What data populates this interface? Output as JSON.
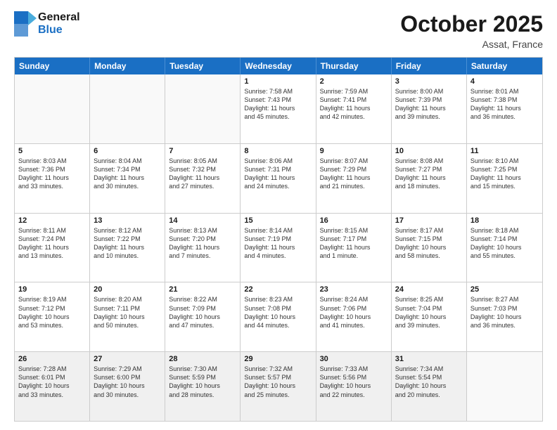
{
  "header": {
    "logo": {
      "line1": "General",
      "line2": "Blue"
    },
    "title": "October 2025",
    "location": "Assat, France"
  },
  "weekdays": [
    "Sunday",
    "Monday",
    "Tuesday",
    "Wednesday",
    "Thursday",
    "Friday",
    "Saturday"
  ],
  "weeks": [
    [
      {
        "day": "",
        "text": "",
        "empty": true
      },
      {
        "day": "",
        "text": "",
        "empty": true
      },
      {
        "day": "",
        "text": "",
        "empty": true
      },
      {
        "day": "1",
        "text": "Sunrise: 7:58 AM\nSunset: 7:43 PM\nDaylight: 11 hours\nand 45 minutes."
      },
      {
        "day": "2",
        "text": "Sunrise: 7:59 AM\nSunset: 7:41 PM\nDaylight: 11 hours\nand 42 minutes."
      },
      {
        "day": "3",
        "text": "Sunrise: 8:00 AM\nSunset: 7:39 PM\nDaylight: 11 hours\nand 39 minutes."
      },
      {
        "day": "4",
        "text": "Sunrise: 8:01 AM\nSunset: 7:38 PM\nDaylight: 11 hours\nand 36 minutes."
      }
    ],
    [
      {
        "day": "5",
        "text": "Sunrise: 8:03 AM\nSunset: 7:36 PM\nDaylight: 11 hours\nand 33 minutes."
      },
      {
        "day": "6",
        "text": "Sunrise: 8:04 AM\nSunset: 7:34 PM\nDaylight: 11 hours\nand 30 minutes."
      },
      {
        "day": "7",
        "text": "Sunrise: 8:05 AM\nSunset: 7:32 PM\nDaylight: 11 hours\nand 27 minutes."
      },
      {
        "day": "8",
        "text": "Sunrise: 8:06 AM\nSunset: 7:31 PM\nDaylight: 11 hours\nand 24 minutes."
      },
      {
        "day": "9",
        "text": "Sunrise: 8:07 AM\nSunset: 7:29 PM\nDaylight: 11 hours\nand 21 minutes."
      },
      {
        "day": "10",
        "text": "Sunrise: 8:08 AM\nSunset: 7:27 PM\nDaylight: 11 hours\nand 18 minutes."
      },
      {
        "day": "11",
        "text": "Sunrise: 8:10 AM\nSunset: 7:25 PM\nDaylight: 11 hours\nand 15 minutes."
      }
    ],
    [
      {
        "day": "12",
        "text": "Sunrise: 8:11 AM\nSunset: 7:24 PM\nDaylight: 11 hours\nand 13 minutes."
      },
      {
        "day": "13",
        "text": "Sunrise: 8:12 AM\nSunset: 7:22 PM\nDaylight: 11 hours\nand 10 minutes."
      },
      {
        "day": "14",
        "text": "Sunrise: 8:13 AM\nSunset: 7:20 PM\nDaylight: 11 hours\nand 7 minutes."
      },
      {
        "day": "15",
        "text": "Sunrise: 8:14 AM\nSunset: 7:19 PM\nDaylight: 11 hours\nand 4 minutes."
      },
      {
        "day": "16",
        "text": "Sunrise: 8:15 AM\nSunset: 7:17 PM\nDaylight: 11 hours\nand 1 minute."
      },
      {
        "day": "17",
        "text": "Sunrise: 8:17 AM\nSunset: 7:15 PM\nDaylight: 10 hours\nand 58 minutes."
      },
      {
        "day": "18",
        "text": "Sunrise: 8:18 AM\nSunset: 7:14 PM\nDaylight: 10 hours\nand 55 minutes."
      }
    ],
    [
      {
        "day": "19",
        "text": "Sunrise: 8:19 AM\nSunset: 7:12 PM\nDaylight: 10 hours\nand 53 minutes."
      },
      {
        "day": "20",
        "text": "Sunrise: 8:20 AM\nSunset: 7:11 PM\nDaylight: 10 hours\nand 50 minutes."
      },
      {
        "day": "21",
        "text": "Sunrise: 8:22 AM\nSunset: 7:09 PM\nDaylight: 10 hours\nand 47 minutes."
      },
      {
        "day": "22",
        "text": "Sunrise: 8:23 AM\nSunset: 7:08 PM\nDaylight: 10 hours\nand 44 minutes."
      },
      {
        "day": "23",
        "text": "Sunrise: 8:24 AM\nSunset: 7:06 PM\nDaylight: 10 hours\nand 41 minutes."
      },
      {
        "day": "24",
        "text": "Sunrise: 8:25 AM\nSunset: 7:04 PM\nDaylight: 10 hours\nand 39 minutes."
      },
      {
        "day": "25",
        "text": "Sunrise: 8:27 AM\nSunset: 7:03 PM\nDaylight: 10 hours\nand 36 minutes."
      }
    ],
    [
      {
        "day": "26",
        "text": "Sunrise: 7:28 AM\nSunset: 6:01 PM\nDaylight: 10 hours\nand 33 minutes."
      },
      {
        "day": "27",
        "text": "Sunrise: 7:29 AM\nSunset: 6:00 PM\nDaylight: 10 hours\nand 30 minutes."
      },
      {
        "day": "28",
        "text": "Sunrise: 7:30 AM\nSunset: 5:59 PM\nDaylight: 10 hours\nand 28 minutes."
      },
      {
        "day": "29",
        "text": "Sunrise: 7:32 AM\nSunset: 5:57 PM\nDaylight: 10 hours\nand 25 minutes."
      },
      {
        "day": "30",
        "text": "Sunrise: 7:33 AM\nSunset: 5:56 PM\nDaylight: 10 hours\nand 22 minutes."
      },
      {
        "day": "31",
        "text": "Sunrise: 7:34 AM\nSunset: 5:54 PM\nDaylight: 10 hours\nand 20 minutes."
      },
      {
        "day": "",
        "text": "",
        "empty": true
      }
    ]
  ]
}
